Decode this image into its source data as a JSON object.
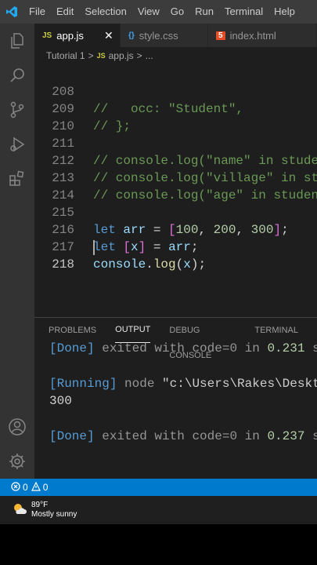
{
  "menu": [
    "File",
    "Edit",
    "Selection",
    "View",
    "Go",
    "Run",
    "Terminal",
    "Help"
  ],
  "tabs": [
    {
      "icon": "JS",
      "label": "app.js",
      "close": "✕",
      "active": true
    },
    {
      "icon": "{}",
      "label": "style.css",
      "active": false
    },
    {
      "icon": "5",
      "label": "index.html",
      "active": false
    }
  ],
  "breadcrumb": {
    "folder": "Tutorial 1",
    "sep1": ">",
    "icon": "JS",
    "file": "app.js",
    "sep2": ">",
    "more": "..."
  },
  "editor": {
    "lines": [
      {
        "num": "208",
        "text": "//   occ: \"Student\","
      },
      {
        "num": "209",
        "text": "// };"
      },
      {
        "num": "210",
        "text": ""
      },
      {
        "num": "211",
        "text": "// console.log(\"name\" in studen"
      },
      {
        "num": "212",
        "text": "// console.log(\"village\" in stu"
      },
      {
        "num": "213",
        "text": "// console.log(\"age\" in student"
      },
      {
        "num": "214",
        "text": ""
      },
      {
        "num": "215",
        "parts": [
          "let",
          " arr",
          " = ",
          "[",
          "100",
          ", ",
          "200",
          ", ",
          "300",
          "]",
          ";"
        ]
      },
      {
        "num": "216",
        "parts": [
          "let",
          " ",
          "[",
          "x",
          "]",
          " = ",
          "arr",
          ";"
        ]
      },
      {
        "num": "217",
        "parts": [
          "console",
          ".",
          "log",
          "(",
          "x",
          ");"
        ]
      },
      {
        "num": "218",
        "text": ""
      }
    ]
  },
  "panel": {
    "tabs": [
      "PROBLEMS",
      "OUTPUT",
      "DEBUG CONSOLE",
      "TERMINAL"
    ],
    "active_tab": "OUTPUT",
    "output": {
      "line1": {
        "tag": "[Done]",
        "mid": " exited with ",
        "code": "code=0",
        "in": " in ",
        "time": "0.231",
        "tail": " se"
      },
      "line2": {
        "tag": "[Running]",
        "cmd": " node ",
        "path": "\"c:\\Users\\Rakes\\Desktop"
      },
      "line3": "300",
      "line4": {
        "tag": "[Done]",
        "mid": " exited with ",
        "code": "code=0",
        "in": " in ",
        "time": "0.237",
        "tail": " se"
      }
    }
  },
  "status": {
    "errors": "0",
    "warnings": "0"
  },
  "taskbar": {
    "temp": "89°F",
    "desc": "Mostly sunny"
  },
  "colors": {
    "accent": "#007acc",
    "comment": "#6a9955",
    "keyword": "#569cd6"
  }
}
